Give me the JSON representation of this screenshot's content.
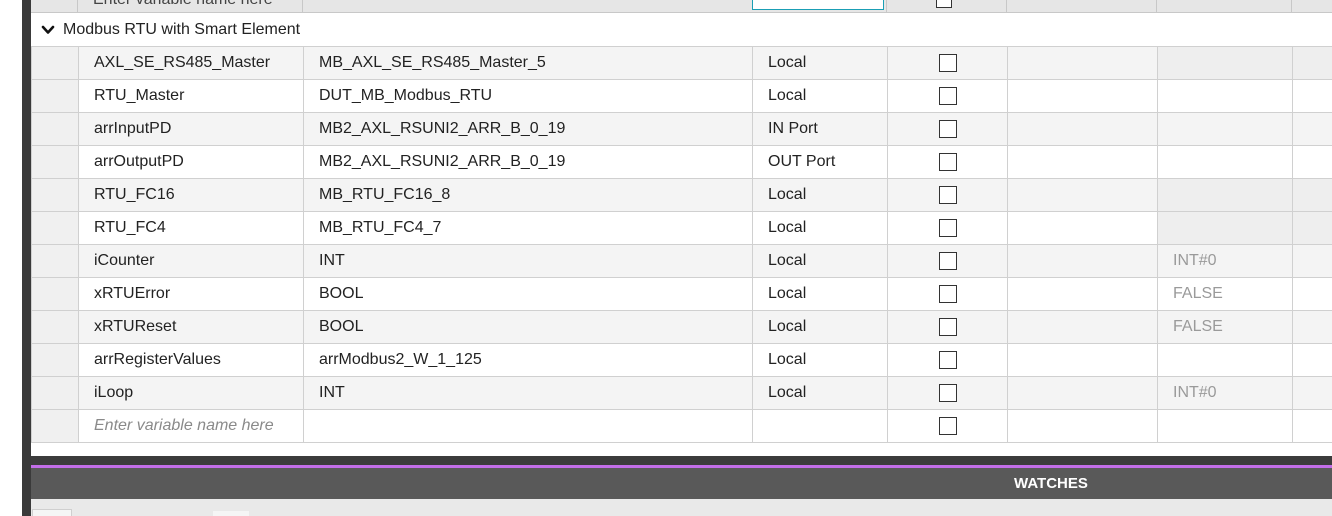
{
  "top_row": {
    "name_placeholder": "Enter variable name here"
  },
  "group": {
    "title": "Modbus RTU with Smart Element"
  },
  "rows": [
    {
      "name": "AXL_SE_RS485_Master",
      "type": "MB_AXL_SE_RS485_Master_5",
      "usage": "Local",
      "init": ""
    },
    {
      "name": "RTU_Master",
      "type": "DUT_MB_Modbus_RTU",
      "usage": "Local",
      "init": ""
    },
    {
      "name": "arrInputPD",
      "type": "MB2_AXL_RSUNI2_ARR_B_0_19",
      "usage": "IN Port",
      "init": ""
    },
    {
      "name": "arrOutputPD",
      "type": "MB2_AXL_RSUNI2_ARR_B_0_19",
      "usage": "OUT Port",
      "init": ""
    },
    {
      "name": "RTU_FC16",
      "type": "MB_RTU_FC16_8",
      "usage": "Local",
      "init": ""
    },
    {
      "name": "RTU_FC4",
      "type": "MB_RTU_FC4_7",
      "usage": "Local",
      "init": ""
    },
    {
      "name": "iCounter",
      "type": "INT",
      "usage": "Local",
      "init": "INT#0"
    },
    {
      "name": "xRTUError",
      "type": "BOOL",
      "usage": "Local",
      "init": "FALSE"
    },
    {
      "name": "xRTUReset",
      "type": "BOOL",
      "usage": "Local",
      "init": "FALSE"
    },
    {
      "name": "arrRegisterValues",
      "type": "arrModbus2_W_1_125",
      "usage": "Local",
      "init": ""
    },
    {
      "name": "iLoop",
      "type": "INT",
      "usage": "Local",
      "init": "INT#0"
    }
  ],
  "new_row": {
    "placeholder": "Enter variable name here"
  },
  "watches": {
    "label": "WATCHES"
  },
  "colors": {
    "accent_purple": "#c26ee8",
    "input_focus": "#1a9fb5",
    "watches_bar": "#595959"
  },
  "icons": {
    "group_toggle": "chevron-down-icon",
    "checkbox": "checkbox-unchecked-icon"
  }
}
